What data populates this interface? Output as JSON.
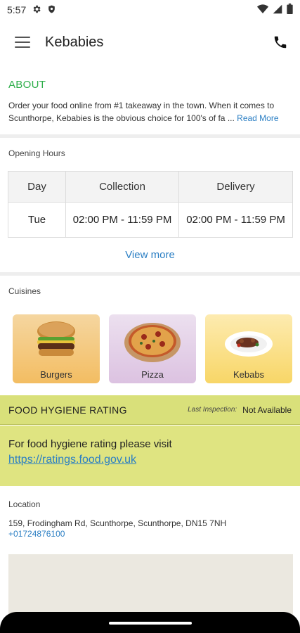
{
  "status_bar": {
    "time": "5:57"
  },
  "app_bar": {
    "title": "Kebabies"
  },
  "about": {
    "title": "ABOUT",
    "text": "Order your food online from #1 takeaway in the town. When it comes to Scunthorpe, Kebabies is the obvious choice for 100's of fa ... ",
    "read_more": "Read More"
  },
  "opening_hours": {
    "label": "Opening Hours",
    "columns": [
      "Day",
      "Collection",
      "Delivery"
    ],
    "rows": [
      {
        "day": "Tue",
        "collection": "02:00 PM - 11:59 PM",
        "delivery": "02:00 PM - 11:59 PM"
      }
    ],
    "view_more": "View more"
  },
  "cuisines": {
    "label": "Cuisines",
    "items": [
      {
        "label": "Burgers",
        "icon": "burger-icon"
      },
      {
        "label": "Pizza",
        "icon": "pizza-icon"
      },
      {
        "label": "Kebabs",
        "icon": "kebab-plate-icon"
      }
    ]
  },
  "hygiene": {
    "title": "FOOD HYGIENE RATING",
    "last_inspection_label": "Last Inspection:",
    "last_inspection_value": "Not Available",
    "text": "For food hygiene rating please visit",
    "link": "https://ratings.food.gov.uk"
  },
  "location": {
    "label": "Location",
    "address": "159, Frodingham Rd, Scunthorpe, Scunthorpe, DN15 7NH",
    "phone": "+01724876100"
  },
  "colors": {
    "accent_green": "#2eae4a",
    "link_blue": "#2b7fc4",
    "hygiene_bg": "#d9e07a"
  }
}
